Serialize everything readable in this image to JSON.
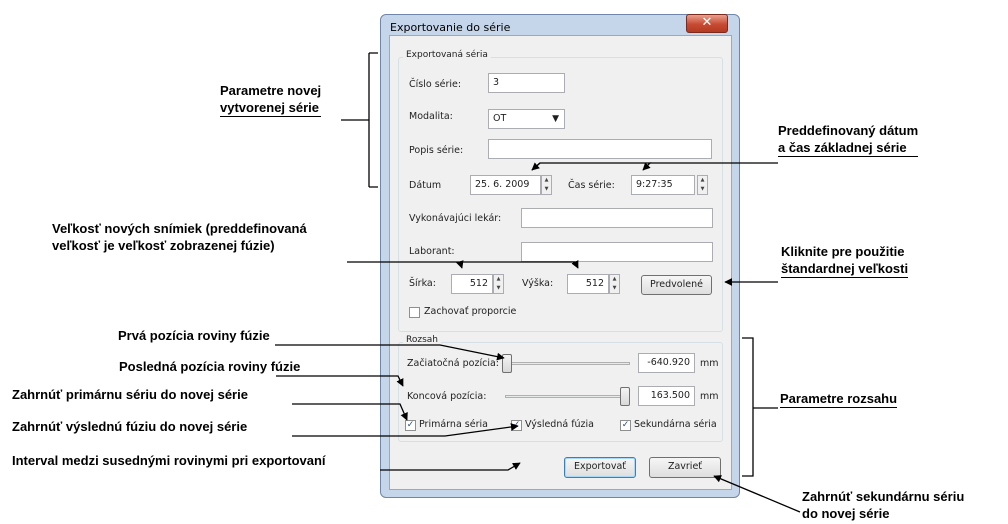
{
  "dialog": {
    "title": "Exportovanie do série",
    "close_glyph": "✕",
    "exported_group": {
      "title": "Exportovaná séria",
      "series_number_label": "Číslo série:",
      "series_number_value": "3",
      "modality_label": "Modalita:",
      "modality_value": "OT",
      "description_label": "Popis série:",
      "description_value": "",
      "date_label": "Dátum",
      "date_value": "25.  6. 2009",
      "time_label": "Čas série:",
      "time_value": "9:27:35",
      "physician_label": "Vykonávajúci lekár:",
      "physician_value": "",
      "technician_label": "Laborant:",
      "technician_value": "",
      "width_label": "Šírka:",
      "width_value": "512",
      "height_label": "Výška:",
      "height_value": "512",
      "default_button": "Predvolené",
      "keep_ratio_label": "Zachovať proporcie",
      "keep_ratio_checked": false
    },
    "range_group": {
      "title": "Rozsah",
      "start_label": "Začiatočná pozícia:",
      "start_value": "-640.920",
      "start_unit": "mm",
      "start_fraction": 0.0,
      "end_label": "Koncová pozícia:",
      "end_value": "163.500",
      "end_unit": "mm",
      "end_fraction": 1.0,
      "primary_label": "Primárna séria",
      "primary_checked": true,
      "fusion_label": "Výsledná fúzia",
      "fusion_checked": true,
      "secondary_label": "Sekundárna séria",
      "secondary_checked": true
    },
    "export_button": "Exportovať",
    "close_button": "Zavrieť"
  },
  "annotations": {
    "new_series_params_1": "Parametre novej",
    "new_series_params_2": "vytvorenej série",
    "predefined_date_1": "Preddefinovaný dátum",
    "predefined_date_2": "a čas základnej série",
    "image_size_1": "Veľkosť nových snímiek (preddefinovaná",
    "image_size_2": "veľkosť je veľkosť zobrazenej fúzie)",
    "standard_size_1": "Kliknite pre použitie",
    "standard_size_2": "štandardnej veľkosti",
    "first_plane": "Prvá pozícia roviny fúzie",
    "last_plane": "Posledná pozícia roviny fúzie",
    "include_primary": "Zahrnúť primárnu sériu do novej série",
    "include_fusion": "Zahrnúť výslednú fúziu do novej série",
    "interval": "Interval medzi susednými rovinymi pri exportovaní",
    "range_params": "Parametre rozsahu",
    "include_secondary_1": "Zahrnúť sekundárnu sériu",
    "include_secondary_2": "do novej série"
  },
  "colors": {
    "frame": "#c5d6ea",
    "close": "#c74a32",
    "check": "#2a4a8a"
  }
}
